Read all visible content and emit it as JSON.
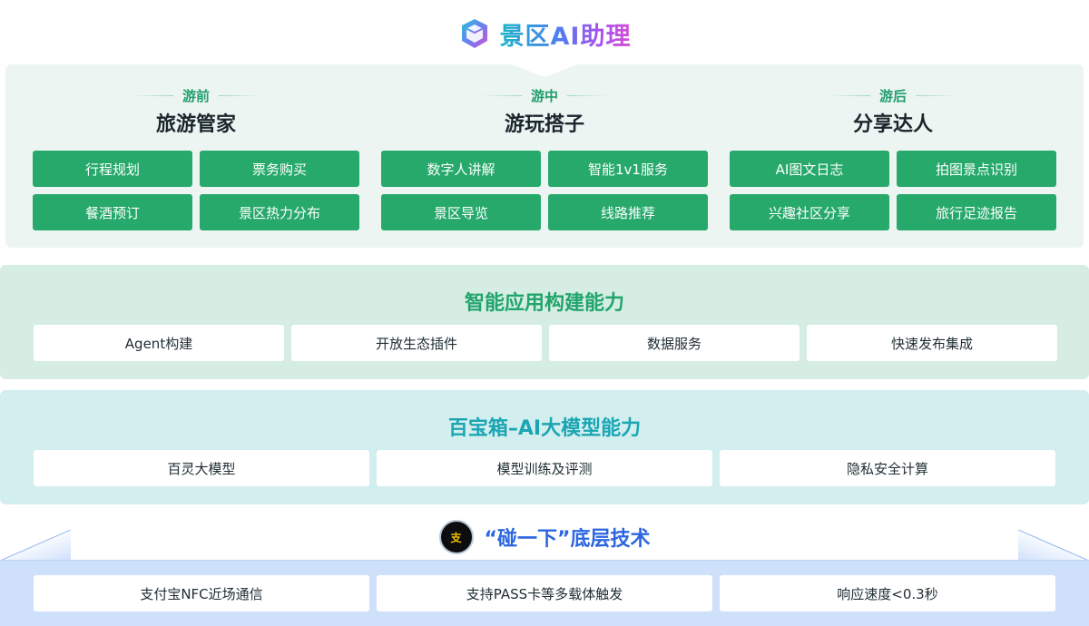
{
  "header": {
    "title": "景区AI助理"
  },
  "stages": [
    {
      "sub": "游前",
      "title": "旅游管家",
      "items": [
        "行程规划",
        "票务购买",
        "餐酒预订",
        "景区热力分布"
      ]
    },
    {
      "sub": "游中",
      "title": "游玩搭子",
      "items": [
        "数字人讲解",
        "智能1v1服务",
        "景区导览",
        "线路推荐"
      ]
    },
    {
      "sub": "游后",
      "title": "分享达人",
      "items": [
        "AI图文日志",
        "拍图景点识别",
        "兴趣社区分享",
        "旅行足迹报告"
      ]
    }
  ],
  "app_layer": {
    "title": "智能应用构建能力",
    "items": [
      "Agent构建",
      "开放生态插件",
      "数据服务",
      "快速发布集成"
    ]
  },
  "model_layer": {
    "title": "百宝箱–AI大模型能力",
    "items": [
      "百灵大模型",
      "模型训练及评测",
      "隐私安全计算"
    ]
  },
  "tech_layer": {
    "title": "“碰一下”底层技术",
    "icon_text": "支",
    "items": [
      "支付宝NFC近场通信",
      "支持PASS卡等多载体触发",
      "响应速度<0.3秒"
    ]
  },
  "colors": {
    "green": "#26a96b",
    "teal": "#1aa6b3",
    "blue": "#2c66e0"
  }
}
